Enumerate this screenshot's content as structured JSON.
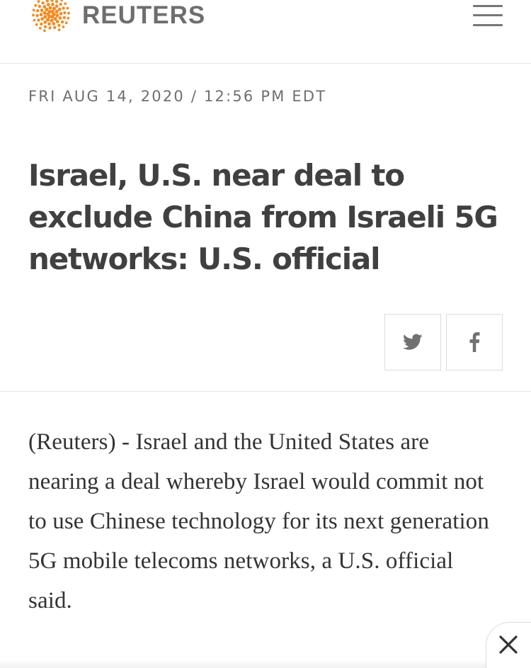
{
  "header": {
    "logo_text": "REUTERS",
    "logo_icon": "reuters-dot-ring-icon",
    "menu_icon": "hamburger-menu-icon",
    "brand_color": "#f28b21"
  },
  "article": {
    "dateline": "FRI AUG 14, 2020 / 12:56 PM EDT",
    "headline": "Israel, U.S. near deal to exclude China from Israeli 5G networks: U.S. official",
    "body": "(Reuters) - Israel and the United States are nearing a deal whereby Israel would commit not to use Chinese technology for its next generation 5G mobile telecoms networks, a U.S. official said."
  },
  "share": {
    "twitter_icon": "twitter-icon",
    "facebook_icon": "facebook-icon"
  },
  "overlay": {
    "close_icon": "close-icon"
  }
}
